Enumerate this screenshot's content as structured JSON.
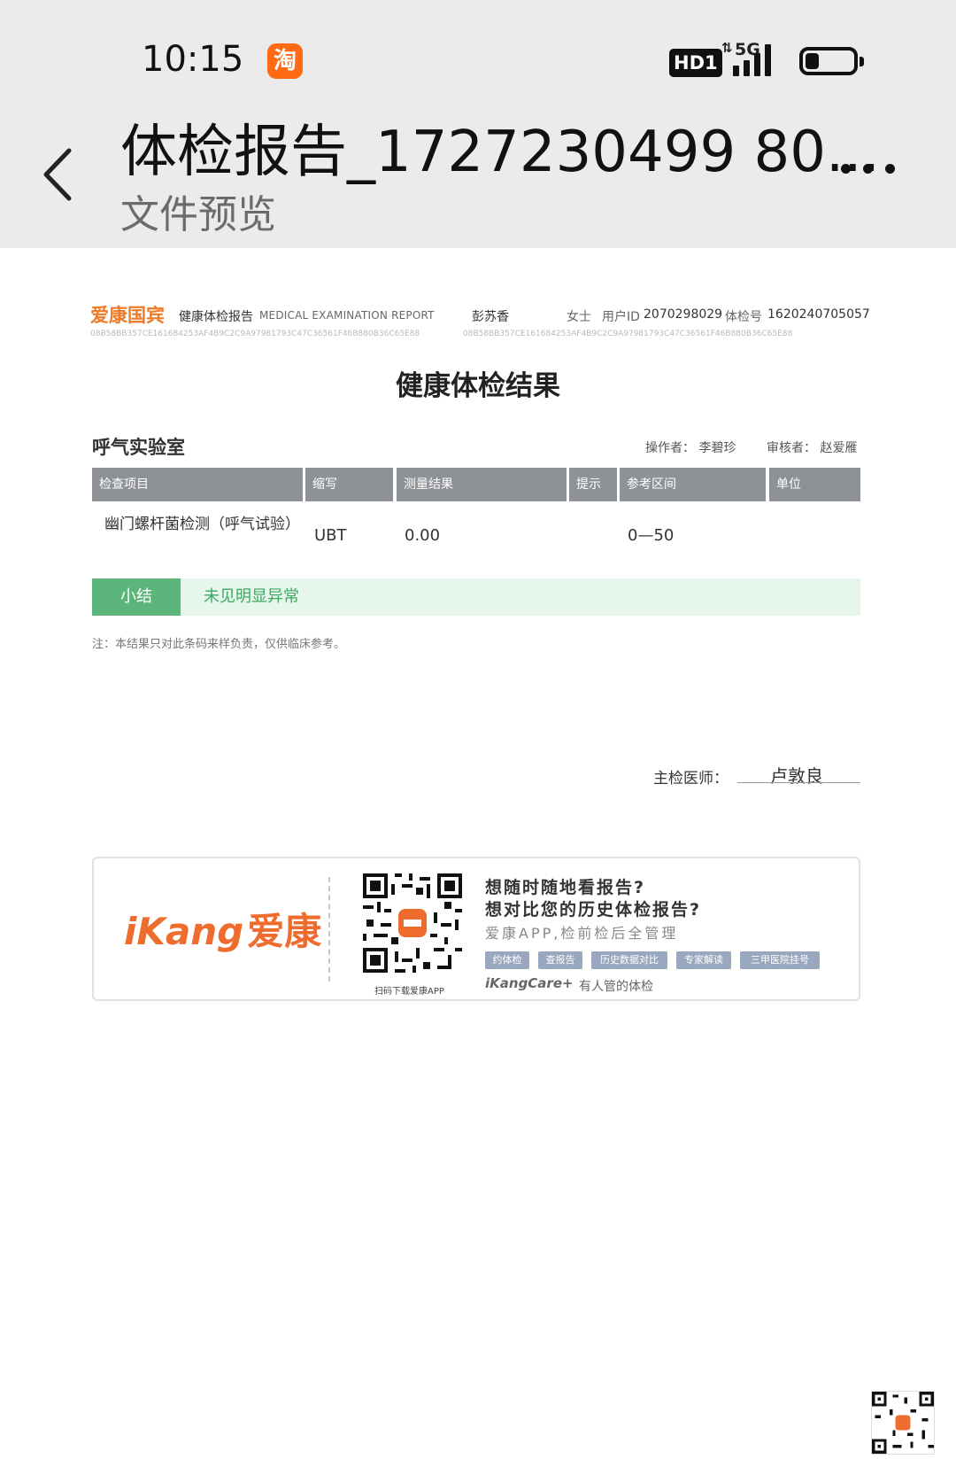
{
  "status_bar": {
    "time": "10:15",
    "app_icon_glyph": "淘",
    "hd_label": "HD1",
    "network_label": "5G",
    "network_arrow": "⇅"
  },
  "header": {
    "title": "体检报告_1727230499 80...",
    "subtitle": "文件预览"
  },
  "report": {
    "brand": "爱康国宾",
    "report_name_cn": "健康体检报告",
    "report_name_en": "MEDICAL EXAMINATION REPORT",
    "patient_name": "彭苏香",
    "sex": "女士",
    "user_id_label": "用户ID",
    "user_id": "2070298029",
    "exam_no_label": "体检号",
    "exam_no": "1620240705057",
    "hash": "08B58BB357CE161684253AF4B9C2C9A97981793C47C36561F46B880B36C65E88",
    "title": "健康体检结果",
    "lab_name": "呼气实验室",
    "operator": "操作者：  李碧珍",
    "reviewer": "审核者：  赵爱雁",
    "columns": [
      "检查项目",
      "缩写",
      "测量结果",
      "提示",
      "参考区间",
      "单位"
    ],
    "rows": [
      {
        "item": "幽门螺杆菌检测（呼气试验）",
        "abbr": "UBT",
        "result": "0.00",
        "hint": "",
        "range": "0—50",
        "unit": ""
      }
    ],
    "summary_label": "小结",
    "summary_text": "未见明显异常",
    "note": "注：本结果只对此条码来样负责，仅供临床参考。",
    "doctor_label": "主检医师：",
    "doctor_name": "卢敦良"
  },
  "banner": {
    "logo_latin": "iKang",
    "logo_cn": "爱康",
    "qr_caption": "扫码下载爱康APP",
    "line1": "想随时随地看报告?",
    "line2": "想对比您的历史体检报告?",
    "line3": "爱康APP,检前检后全管理",
    "tags": [
      "约体检",
      "查报告",
      "历史数据对比",
      "专家解读",
      "三甲医院挂号"
    ],
    "care_logo": "iKangCare+",
    "slogan": "有人管的体检"
  }
}
